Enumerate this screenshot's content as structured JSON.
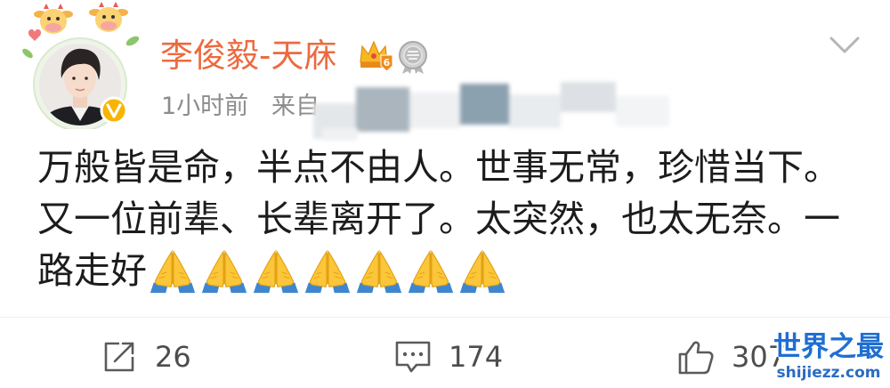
{
  "post": {
    "author": {
      "name": "李俊毅-天庥",
      "avatar_icon": "user-avatar",
      "frame_icon": "cow-avatar-frame",
      "verified_icon": "verified-v-badge",
      "crown_icon": "crown-icon",
      "crown_level": "6",
      "medal_icon": "medal-icon"
    },
    "menu_icon": "chevron-down-icon",
    "meta": {
      "time": "1小时前",
      "source_prefix": "来自"
    },
    "body_lines": [
      "万般皆是命，半点不由人。世事无常，珍惜当下。",
      "又一位前辈、长辈离开了。太突然，也太无奈。一",
      "路走好"
    ],
    "body_emoji": [
      "folded-hands",
      "folded-hands",
      "folded-hands",
      "folded-hands",
      "folded-hands",
      "folded-hands",
      "folded-hands"
    ]
  },
  "actions": {
    "repost": {
      "icon": "share-icon",
      "count": "26"
    },
    "comment": {
      "icon": "comment-icon",
      "count": "174"
    },
    "like": {
      "icon": "thumbs-up-icon",
      "count": "307"
    }
  },
  "watermark": {
    "title": "世界之最",
    "url": "shijiezz.com"
  },
  "colors": {
    "username": "#ec6a3f",
    "meta": "#8c8c8c",
    "body": "#1c1c1c",
    "action": "#4d4d4d",
    "verified": "#f7b500",
    "watermark": "#1f6fd1"
  }
}
